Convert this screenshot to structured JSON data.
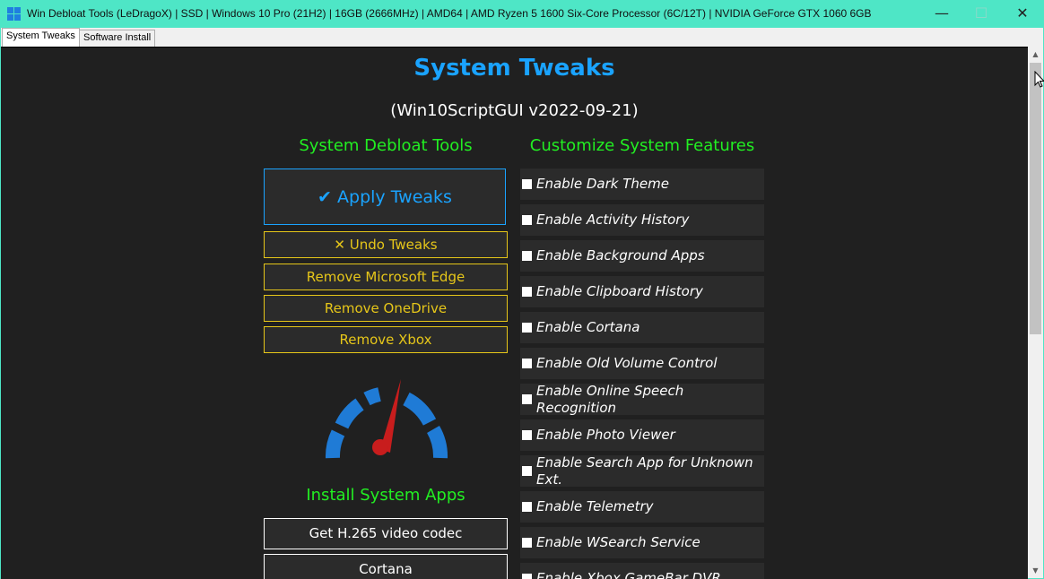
{
  "window": {
    "title": "Win Debloat Tools (LeDragoX) | SSD | Windows 10 Pro (21H2) | 16GB (2666MHz) | AMD64 | AMD Ryzen 5 1600 Six-Core Processor (6C/12T) | NVIDIA GeForce GTX 1060 6GB",
    "minimize": "—",
    "maximize": "☐",
    "close": "✕"
  },
  "tabs": [
    {
      "label": "System Tweaks",
      "active": true
    },
    {
      "label": "Software Install",
      "active": false
    }
  ],
  "page": {
    "title": "System Tweaks",
    "subtitle": "(Win10ScriptGUI v2022-09-21)"
  },
  "debloat": {
    "heading": "System Debloat Tools",
    "apply_label": "✔ Apply Tweaks",
    "undo_label": "✕ Undo Tweaks",
    "buttons": [
      "Remove Microsoft Edge",
      "Remove OneDrive",
      "Remove Xbox"
    ]
  },
  "gauge_icon": "speedometer-icon",
  "install": {
    "heading": "Install System Apps",
    "buttons": [
      "Get H.265 video codec",
      "Cortana"
    ]
  },
  "features": {
    "heading": "Customize System Features",
    "items": [
      "Enable Dark Theme",
      "Enable Activity History",
      "Enable Background Apps",
      "Enable Clipboard History",
      "Enable Cortana",
      "Enable Old Volume Control",
      "Enable Online Speech Recognition",
      "Enable Photo Viewer",
      "Enable Search App for Unknown Ext.",
      "Enable Telemetry",
      "Enable WSearch Service",
      "Enable Xbox GameBar DVR"
    ]
  },
  "colors": {
    "titlebar": "#4ee6c6",
    "background": "#202020",
    "accent_blue": "#1aa3ff",
    "heading_green": "#22ee22",
    "button_yellow": "#e6c619"
  }
}
